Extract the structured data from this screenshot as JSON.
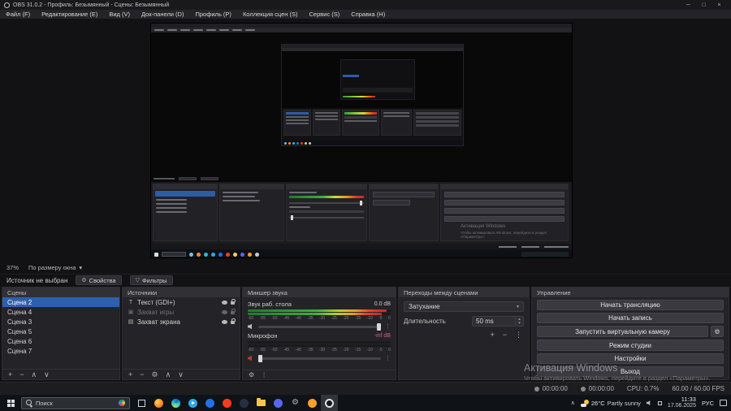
{
  "window": {
    "title": "OBS 31.0.2 - Профиль: Безымянный - Сцены: Безымянный"
  },
  "glyphs": {
    "minimize": "─",
    "maximize": "□",
    "close": "×",
    "caret_down": "▾",
    "spin_up": "▴",
    "spin_down": "▾",
    "plus": "+",
    "remove": "−",
    "up": "∧",
    "down": "∨",
    "gear": "⚙",
    "kebab": "⋮",
    "filter": "▽",
    "chevron_up": "∧",
    "text_source": "T",
    "game_source": "▣",
    "screen_source": "▤"
  },
  "menu": {
    "items": [
      "Файл (F)",
      "Редактирование (E)",
      "Вид (V)",
      "Док-панели (D)",
      "Профиль (P)",
      "Коллекция сцен (S)",
      "Сервис (S)",
      "Справка (H)"
    ]
  },
  "preview": {
    "zoom": "37%",
    "fit_mode": "По размеру окна"
  },
  "source_bar": {
    "status": "Источник не выбран",
    "properties": "Свойства",
    "filters": "Фильтры"
  },
  "scenes": {
    "title": "Сцены",
    "items": [
      "Сцена 2",
      "Сцена 4",
      "Сцена 3",
      "Сцена 5",
      "Сцена 6",
      "Сцена 7"
    ]
  },
  "sources": {
    "title": "Источники",
    "items": [
      {
        "label": "Текст (GDI+)"
      },
      {
        "label": "Захват игры"
      },
      {
        "label": "Захват экрана"
      }
    ]
  },
  "mixer": {
    "title": "Микшер звука",
    "channels": [
      {
        "name": "Звук раб. стола",
        "db": "0.0 dB"
      },
      {
        "name": "Микрофон",
        "db": "-inf dB"
      }
    ],
    "scale": [
      "-60",
      "-55",
      "-50",
      "-45",
      "-40",
      "-35",
      "-30",
      "-25",
      "-20",
      "-15",
      "-10",
      "-5",
      "0"
    ]
  },
  "transitions": {
    "title": "Переходы между сценами",
    "type": "Затухание",
    "duration_label": "Длительность",
    "duration_value": "50 ms"
  },
  "controls": {
    "title": "Управление",
    "buttons": [
      "Начать трансляцию",
      "Начать запись",
      "Запустить виртуальную камеру",
      "Режим студии",
      "Настройки",
      "Выход"
    ]
  },
  "watermark": {
    "title": "Активация Windows",
    "sub": "Чтобы активировать Windows, перейдите в раздел «Параметры»."
  },
  "statusbar": {
    "timer1": "00:00:00",
    "timer2": "00:00:00",
    "cpu": "CPU: 0.7%",
    "fps": "60.00 / 60.00 FPS"
  },
  "taskbar": {
    "search": "Поиск",
    "tray": {
      "temperature": "26°C",
      "weather": "Partly sunny",
      "time": "11:33",
      "date": "17.06.2025",
      "language": "РУС"
    }
  },
  "accent_colors": {
    "selection_blue": "#2e5fae",
    "meter_green": "#3fae3f",
    "meter_red": "#c62828",
    "mute_red": "#c0392b"
  }
}
